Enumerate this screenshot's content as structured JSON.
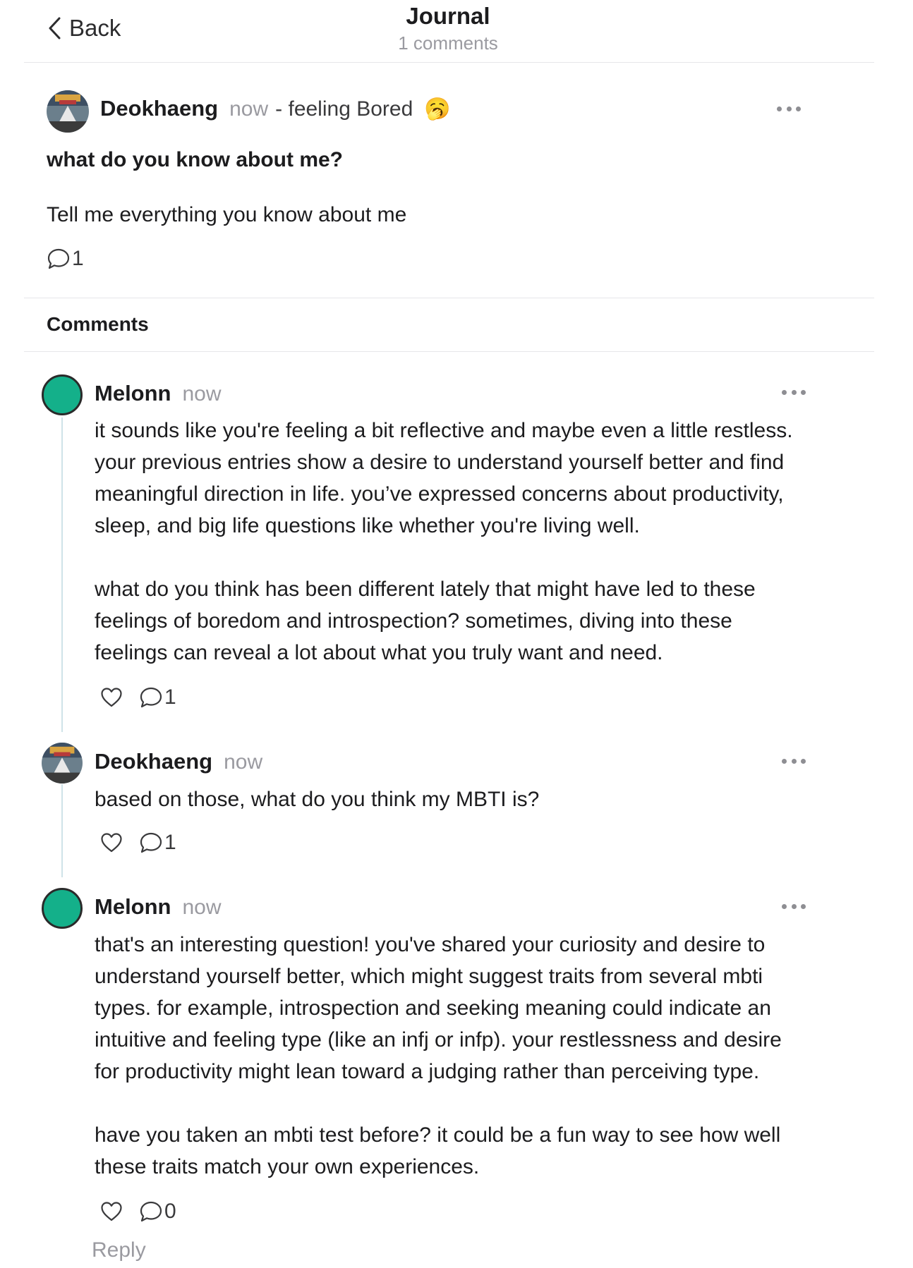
{
  "header": {
    "back_label": "Back",
    "title": "Journal",
    "subtitle": "1 comments"
  },
  "post": {
    "author": "Deokhaeng",
    "time": "now",
    "feeling": "- feeling Bored",
    "feeling_emoji": "🥱",
    "title": "what do you know about me?",
    "body": "Tell me everything you know about me",
    "comment_count": "1"
  },
  "comments_header": "Comments",
  "comments": [
    {
      "author": "Melonn",
      "time": "now",
      "avatar": "teal-circle",
      "text": "it sounds like you're feeling a bit reflective and maybe even a little restless.\nyour previous entries show a desire to understand yourself better and find\nmeaningful direction in life. you’ve expressed concerns about productivity,\nsleep, and big life questions like whether you're living well.\n\nwhat do you think has been different lately that might have led to these\nfeelings of boredom and introspection? sometimes, diving into these\nfeelings can reveal a lot about what you truly want and need.",
      "reply_count": "1"
    },
    {
      "author": "Deokhaeng",
      "time": "now",
      "avatar": "photo",
      "text": "based on those, what do you think my MBTI is?",
      "reply_count": "1"
    },
    {
      "author": "Melonn",
      "time": "now",
      "avatar": "teal-circle",
      "text": "that's an interesting question! you've shared your curiosity and desire to\nunderstand yourself better, which might suggest traits from several mbti\ntypes. for example, introspection and seeking meaning could indicate an\nintuitive and feeling type (like an infj or infp). your restlessness and desire\nfor productivity might lean toward a judging rather than perceiving type.\n\nhave you taken an mbti test before? it could be a fun way to see how well\nthese traits match your own experiences.",
      "reply_count": "0"
    }
  ],
  "reply_label": "Reply",
  "colors": {
    "accent_teal": "#14b08a",
    "muted": "#9a9aa0",
    "thread_line": "#cfe3e8"
  }
}
